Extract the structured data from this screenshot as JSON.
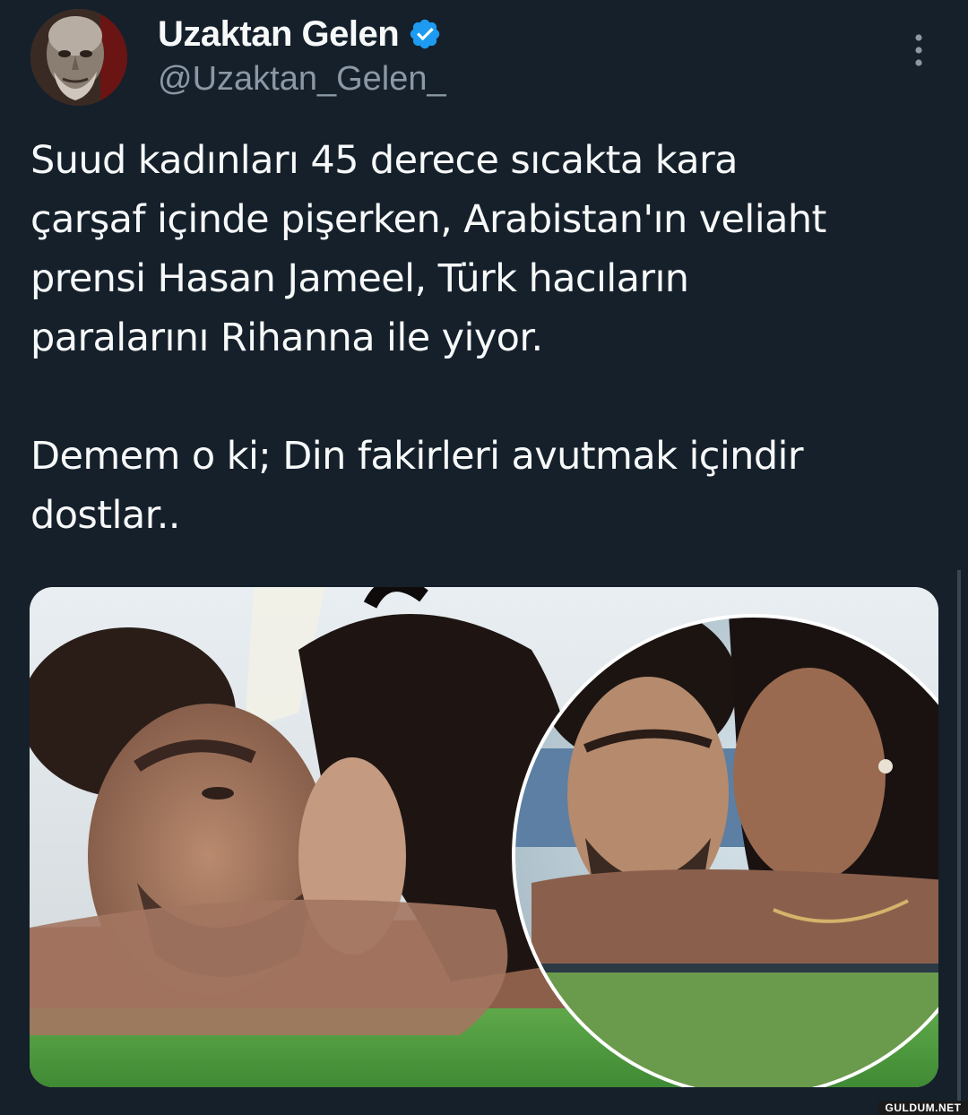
{
  "tweet": {
    "author": {
      "display_name": "Uzaktan Gelen",
      "handle": "@Uzaktan_Gelen_",
      "verified": true
    },
    "text": "Suud kadınları 45 derece sıcakta kara\nçarşaf içinde pişerken, Arabistan'ın veliaht\nprensi Hasan Jameel, Türk hacıların\nparalarını Rihanna ile yiyor.\n\nDemem o ki; Din fakirleri avutmak içindir\ndostlar..",
    "media": {
      "type": "photo"
    }
  },
  "icons": {
    "verified": "verified-badge-icon",
    "more": "more-vertical-icon"
  },
  "watermark": "GULDUM.NET",
  "colors": {
    "background": "#15202b",
    "text_primary": "#f7f9f9",
    "text_secondary": "#8b98a5",
    "verified_blue": "#1d9bf0"
  }
}
